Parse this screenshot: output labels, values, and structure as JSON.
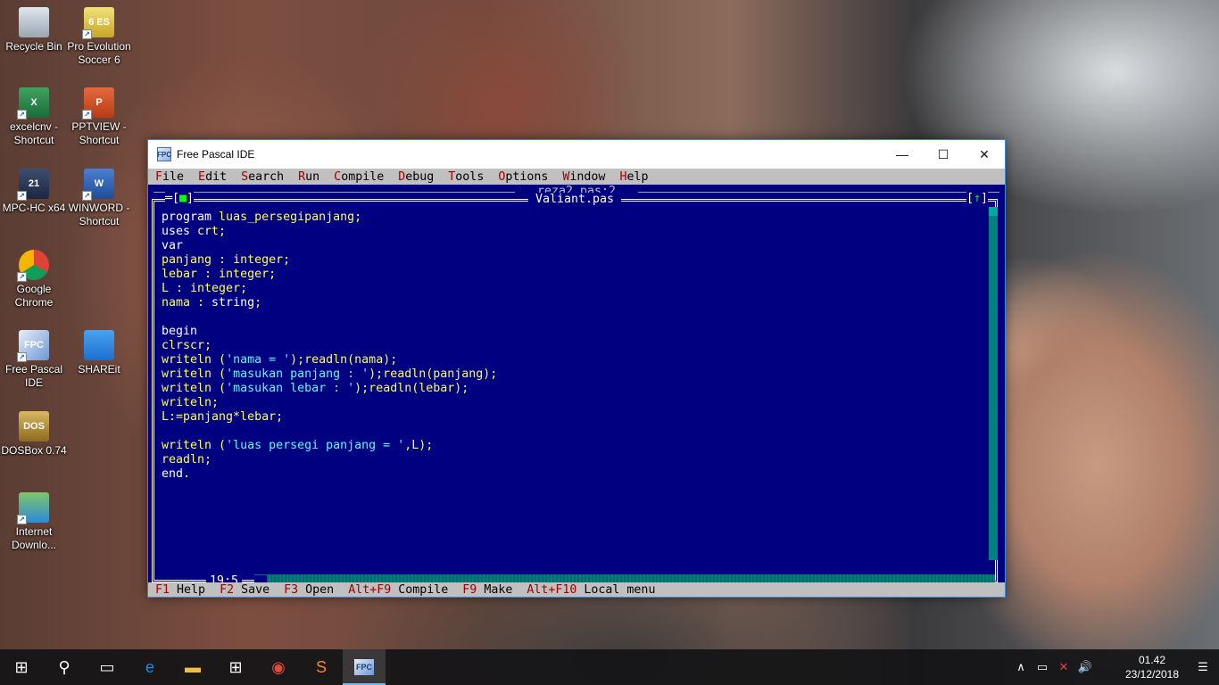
{
  "desktop": {
    "icons": [
      {
        "label": "Recycle Bin",
        "icon": "recycle-bin-icon"
      },
      {
        "label": "Pro Evolution Soccer 6",
        "icon": "pes6-icon",
        "glyph": "6 ES"
      },
      {
        "label": "excelcnv - Shortcut",
        "icon": "excel-icon",
        "glyph": "X"
      },
      {
        "label": "PPTVIEW - Shortcut",
        "icon": "powerpoint-icon",
        "glyph": "P"
      },
      {
        "label": "MPC-HC x64",
        "icon": "mpc-hc-icon",
        "glyph": "21"
      },
      {
        "label": "WINWORD - Shortcut",
        "icon": "word-icon",
        "glyph": "W"
      },
      {
        "label": "Google Chrome",
        "icon": "chrome-icon"
      },
      {
        "label": "Free Pascal IDE",
        "icon": "free-pascal-icon",
        "glyph": "FPC"
      },
      {
        "label": "SHAREit",
        "icon": "shareit-icon"
      },
      {
        "label": "DOSBox 0.74",
        "icon": "dosbox-icon",
        "glyph": "DOS"
      },
      {
        "label": "Internet Downlo...",
        "icon": "internet-download-manager-icon"
      }
    ]
  },
  "window": {
    "title": "Free Pascal IDE",
    "app_icon_glyph": "FPC",
    "controls": {
      "minimize": "—",
      "maximize": "☐",
      "close": "✕"
    },
    "menu": [
      {
        "hotkey": "F",
        "rest": "ile"
      },
      {
        "hotkey": "E",
        "rest": "dit"
      },
      {
        "hotkey": "S",
        "rest": "earch"
      },
      {
        "hotkey": "R",
        "rest": "un"
      },
      {
        "hotkey": "C",
        "rest": "ompile"
      },
      {
        "hotkey": "D",
        "rest": "ebug"
      },
      {
        "hotkey": "T",
        "rest": "ools"
      },
      {
        "hotkey": "O",
        "rest": "ptions"
      },
      {
        "hotkey": "W",
        "rest": "indow"
      },
      {
        "hotkey": "H",
        "rest": "elp"
      }
    ],
    "background_window_title": "reza2.pas:2",
    "editor": {
      "title": "Valiant.pas",
      "close_box": "[■]",
      "zoom_box": "[↑]",
      "cursor_position": "19:5",
      "lines": [
        "program luas_persegipanjang;",
        "uses crt;",
        "var",
        "panjang : integer;",
        "lebar : integer;",
        "L : integer;",
        "nama : string;",
        "",
        "begin",
        "clrscr;",
        "writeln ('nama = ');readln(nama);",
        "writeln ('masukan panjang : ');readln(panjang);",
        "writeln ('masukan lebar : ');readln(lebar);",
        "writeln;",
        "L:=panjang*lebar;",
        "",
        "writeln ('luas persegi panjang = ',L);",
        "readln;",
        "end."
      ]
    },
    "statusbar": [
      {
        "key": "F1",
        "label": "Help"
      },
      {
        "key": "F2",
        "label": "Save"
      },
      {
        "key": "F3",
        "label": "Open"
      },
      {
        "key": "Alt+F9",
        "label": "Compile"
      },
      {
        "key": "F9",
        "label": "Make"
      },
      {
        "key": "Alt+F10",
        "label": "Local menu"
      }
    ]
  },
  "taskbar": {
    "items": [
      {
        "name": "start-button",
        "glyph": "⊞",
        "active": false
      },
      {
        "name": "search-button",
        "glyph": "⚲",
        "active": false
      },
      {
        "name": "task-view-button",
        "glyph": "▭",
        "active": false
      },
      {
        "name": "edge-button",
        "glyph": "e",
        "active": false
      },
      {
        "name": "file-explorer-button",
        "glyph": "▬",
        "active": false
      },
      {
        "name": "store-button",
        "glyph": "⊞",
        "active": false
      },
      {
        "name": "chrome-button",
        "glyph": "◉",
        "active": false
      },
      {
        "name": "sublime-button",
        "glyph": "S",
        "active": false
      },
      {
        "name": "free-pascal-taskbar-button",
        "glyph": "FPC",
        "active": true
      }
    ],
    "tray": {
      "chevron": "∧",
      "battery": "▭",
      "network": "✕",
      "volume": "🔊",
      "notifications": "☰",
      "time": "01.42",
      "date": "23/12/2018"
    }
  },
  "colors": {
    "ide_background": "#000080",
    "code_identifier": "#ffff55",
    "code_keyword": "#ffffff",
    "code_string": "#55ffff",
    "menu_background": "#c0c0c0",
    "hotkey": "#a00000"
  }
}
